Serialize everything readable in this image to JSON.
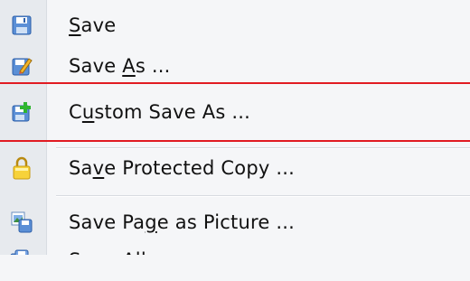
{
  "menu": {
    "items": [
      {
        "before": "",
        "ul": "S",
        "after": "ave",
        "icon": "save-disk-icon"
      },
      {
        "before": "Save ",
        "ul": "A",
        "after": "s ...",
        "icon": "save-as-pencil-icon"
      },
      {
        "before": "C",
        "ul": "u",
        "after": "stom Save As ...",
        "icon": "custom-save-plus-icon"
      },
      {
        "before": "Sa",
        "ul": "v",
        "after": "e Protected Copy ...",
        "icon": "protected-copy-lock-icon"
      },
      {
        "before": "Save Pa",
        "ul": "g",
        "after": "e as Picture ...",
        "icon": "save-page-picture-icon"
      },
      {
        "before": "Save All ...",
        "ul": "",
        "after": "",
        "icon": "save-all-icon"
      }
    ]
  },
  "colors": {
    "highlight": "#e11b22",
    "gutter": "#e7eaee",
    "background": "#f5f6f8"
  }
}
